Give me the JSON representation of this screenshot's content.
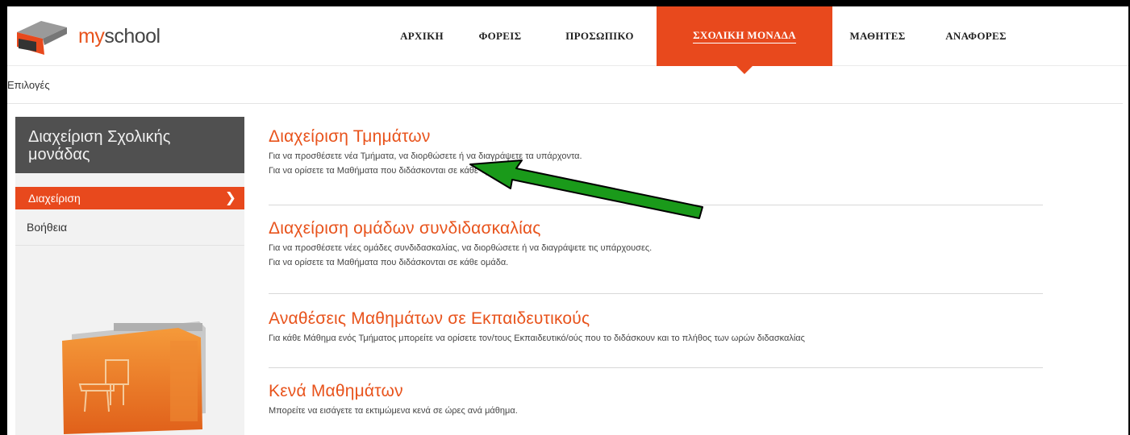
{
  "logo": {
    "text_my": "my",
    "text_school": "school"
  },
  "nav": [
    {
      "label": "ΑΡΧΙΚΗ",
      "active": false
    },
    {
      "label": "ΦΟΡΕΙΣ",
      "active": false
    },
    {
      "label": "ΠΡΟΣΩΠΙΚΟ",
      "active": false
    },
    {
      "label": "ΣΧΟΛΙΚΗ ΜΟΝΑΔΑ",
      "active": true
    },
    {
      "label": "ΜΑΘΗΤΕΣ",
      "active": false
    },
    {
      "label": "ΑΝΑΦΟΡΕΣ",
      "active": false
    }
  ],
  "breadcrumb": "Επιλογές",
  "sidebar": {
    "title": "Διαχείριση Σχολικής μονάδας",
    "active_item": "Διαχείριση",
    "items": [
      {
        "label": "Βοήθεια"
      }
    ]
  },
  "sections": [
    {
      "title": "Διαχείριση Τμημάτων",
      "lines": [
        "Για να προσθέσετε νέα Τμήματα, να διορθώσετε ή να διαγράψετε τα υπάρχοντα.",
        "Για να ορίσετε τα Μαθήματα που διδάσκονται σε κάθε Τμήμα."
      ]
    },
    {
      "title": "Διαχείριση ομάδων συνδιδασκαλίας",
      "lines": [
        "Για να προσθέσετε νέες ομάδες συνδιδασκαλίας, να διορθώσετε ή να διαγράψετε τις υπάρχουσες.",
        "Για να ορίσετε τα Μαθήματα που διδάσκονται σε κάθε ομάδα."
      ]
    },
    {
      "title": "Αναθέσεις Μαθημάτων σε Εκπαιδευτικούς",
      "lines": [
        "Για κάθε Μάθημα ενός Τμήματος μπορείτε να ορίσετε τον/τους Εκπαιδευτικό/ούς που το διδάσκουν και το πλήθος των ωρών διδασκαλίας"
      ]
    },
    {
      "title": "Κενά Μαθημάτων",
      "lines": [
        "Μπορείτε να εισάγετε τα εκτιμώμενα κενά σε ώρες ανά μάθημα."
      ]
    }
  ],
  "colors": {
    "accent": "#e8491d",
    "sidebar_title_bg": "#505050",
    "arrow": "#1a8a1a"
  },
  "annotation": {
    "icon": "green-arrow-icon"
  }
}
